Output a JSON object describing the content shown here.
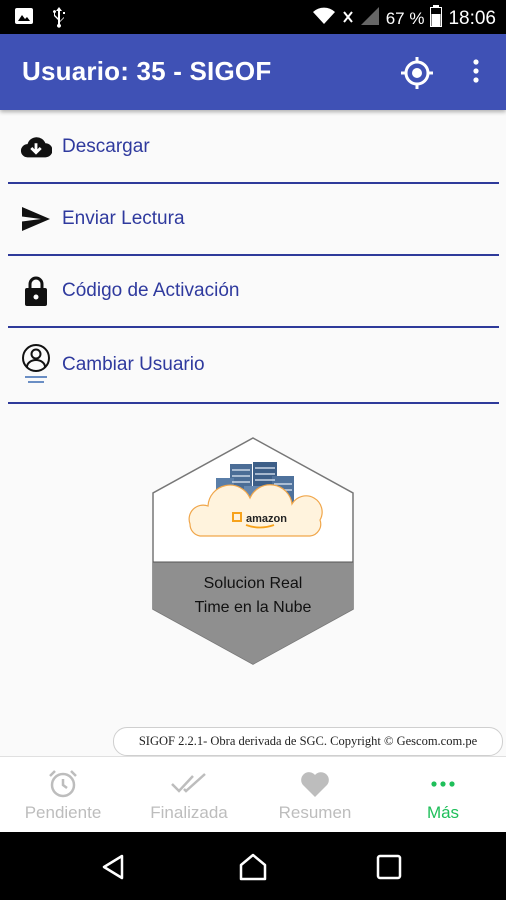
{
  "status_bar": {
    "battery": "67 %",
    "time": "18:06",
    "icons": [
      "image-icon",
      "usb-icon",
      "wifi-icon",
      "no-sim-icon",
      "signal-icon",
      "battery-icon"
    ]
  },
  "app_bar": {
    "title": "Usuario: 35 - SIGOF",
    "icons": [
      "location-target-icon",
      "more-vert-icon"
    ]
  },
  "menu": [
    {
      "label": "Descargar",
      "icon": "cloud-download-icon"
    },
    {
      "label": "Enviar Lectura",
      "icon": "send-icon"
    },
    {
      "label": "Código de Activación",
      "icon": "lock-icon"
    },
    {
      "label": "Cambiar Usuario",
      "icon": "user-switch-icon"
    }
  ],
  "badge": {
    "logo_text": "amazon",
    "caption_line1": "Solucion Real",
    "caption_line2": "Time en la Nube"
  },
  "footer_note": "SIGOF 2.2.1- Obra derivada de SGC. Copyright © Gescom.com.pe",
  "bottom_nav": [
    {
      "label": "Pendiente",
      "icon": "alarm-icon",
      "active": false
    },
    {
      "label": "Finalizada",
      "icon": "double-check-icon",
      "active": false
    },
    {
      "label": "Resumen",
      "icon": "heart-icon",
      "active": false
    },
    {
      "label": "Más",
      "icon": "more-horiz-icon",
      "active": true
    }
  ],
  "colors": {
    "app_bar": "#3f51b5",
    "menu_text": "#2f3a9e",
    "divider": "#2e3a9a",
    "active_nav": "#1fbf5a",
    "inactive_nav": "#bdbdbd"
  }
}
